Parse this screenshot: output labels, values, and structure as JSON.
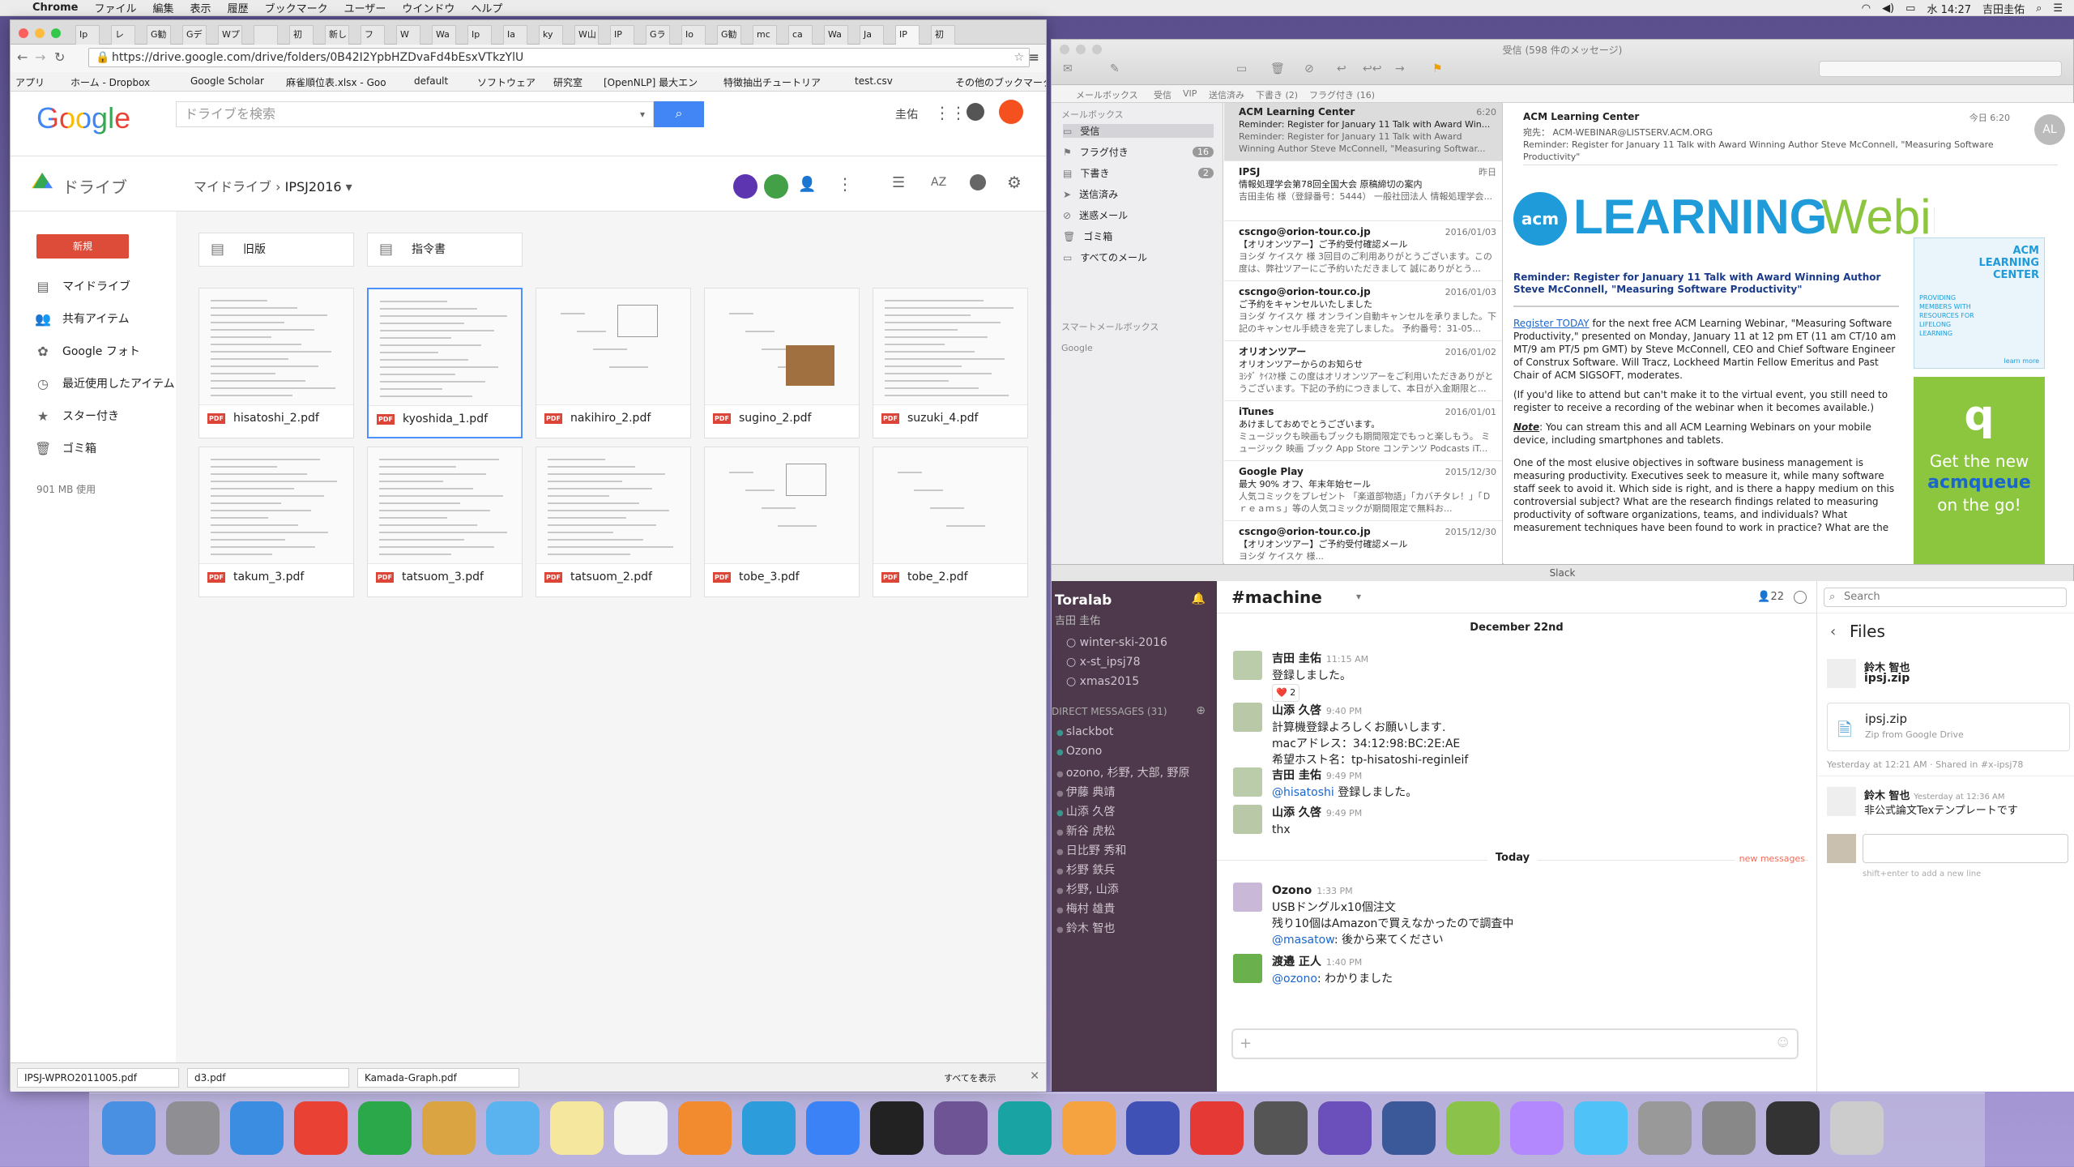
{
  "menubar": {
    "app": "Chrome",
    "items": [
      "ファイル",
      "編集",
      "表示",
      "履歴",
      "ブックマーク",
      "ユーザー",
      "ウインドウ",
      "ヘルプ"
    ],
    "clock": "水 14:27",
    "user": "吉田圭佑"
  },
  "chrome": {
    "tabs": [
      "Ip",
      "レ",
      "G勧",
      "Gデ",
      "Wプ",
      "",
      "初",
      "新し",
      "フ",
      "W",
      "Wa",
      "Ip",
      "Ia",
      "ky",
      "W山",
      "IP",
      "Gラ",
      "Io",
      "G勧",
      "mc",
      "ca",
      "Wa",
      "Ja",
      "IP",
      "初"
    ],
    "url": "https://drive.google.com/drive/folders/0B42I2YpbHZDvaFd4bEsxVTkzYlU",
    "bookmarks": [
      "アプリ",
      "ホーム - Dropbox",
      "Google Scholar",
      "麻雀順位表.xlsx - Goo",
      "default",
      "ソフトウェア",
      "研究室",
      "[OpenNLP] 最大エン",
      "特徴抽出チュートリア",
      "test.csv",
      "その他のブックマーク"
    ],
    "logo": "Google",
    "search_placeholder": "ドライブを検索",
    "user_short": "圭佑",
    "drive_label": "ドライブ",
    "breadcrumb": {
      "root": "マイドライブ",
      "current": "IPSJ2016"
    },
    "new_button": "新規",
    "sidebar": [
      "マイドライブ",
      "共有アイテム",
      "Google フォト",
      "最近使用したアイテム",
      "スター付き",
      "ゴミ箱"
    ],
    "storage": "901 MB 使用",
    "folders": [
      "旧版",
      "指令書"
    ],
    "files": [
      "hisatoshi_2.pdf",
      "kyoshida_1.pdf",
      "nakihiro_2.pdf",
      "sugino_2.pdf",
      "suzuki_4.pdf",
      "takum_3.pdf",
      "tatsuom_3.pdf",
      "tatsuom_2.pdf",
      "tobe_3.pdf",
      "tobe_2.pdf"
    ],
    "downloads": [
      "IPSJ-WPRO2011005.pdf",
      "d3.pdf",
      "Kamada-Graph.pdf"
    ],
    "show_all": "すべてを表示"
  },
  "mail": {
    "window_title": "受信 (598 件のメッセージ)",
    "fav": [
      "メールボックス",
      "受信",
      "VIP",
      "送信済み",
      "下書き (2)",
      "フラグ付き (16)"
    ],
    "sidebar_header": "メールボックス",
    "mailboxes": [
      {
        "label": "受信",
        "count": ""
      },
      {
        "label": "フラグ付き",
        "count": "16"
      },
      {
        "label": "下書き",
        "count": "2"
      },
      {
        "label": "送信済み",
        "count": ""
      },
      {
        "label": "迷惑メール",
        "count": ""
      },
      {
        "label": "ゴミ箱",
        "count": ""
      },
      {
        "label": "すべてのメール",
        "count": ""
      }
    ],
    "smart": "スマートメールボックス",
    "google": "Google",
    "messages": [
      {
        "from": "ACM Learning Center",
        "date": "6:20",
        "subject": "Reminder: Register for January 11 Talk with Award Win...",
        "preview": "Reminder: Register for January 11 Talk with Award Winning Author Steve McConnell, \"Measuring Softwar..."
      },
      {
        "from": "IPSJ",
        "date": "昨日",
        "subject": "情報処理学会第78回全国大会 原稿締切の案内",
        "preview": "吉田圭佑 様（登録番号：5444） 一般社団法人 情報処理学会..."
      },
      {
        "from": "cscngo@orion-tour.co.jp",
        "date": "2016/01/03",
        "subject": "【オリオンツアー】ご予約受付確認メール",
        "preview": "ヨシダ ケイスケ 様 3回目のご利用ありがとうございます。この度は、弊社ツアーにご予約いただきまして 誠にありがとう..."
      },
      {
        "from": "cscngo@orion-tour.co.jp",
        "date": "2016/01/03",
        "subject": "ご予約をキャンセルいたしました",
        "preview": "ヨシダ ケイスケ 様 オンライン自動キャンセルを承りました。下記のキャンセル手続きを完了しました。 予約番号：31-05..."
      },
      {
        "from": "オリオンツアー",
        "date": "2016/01/02",
        "subject": "オリオンツアーからのお知らせ",
        "preview": "ﾖｼﾀﾞ ｹｲｽｹ様 この度はオリオンツアーをご利用いただきありがとうございます。下記の予約につきまして、本日が入金期限と..."
      },
      {
        "from": "iTunes",
        "date": "2016/01/01",
        "subject": "あけましておめでとうございます。",
        "preview": "ミュージックも映画もブックも期間限定でもっと楽しもう。 ミュージック 映画 ブック App Store コンテンツ Podcasts iT..."
      },
      {
        "from": "Google Play",
        "date": "2015/12/30",
        "subject": "最大 90% オフ、年末年始セール",
        "preview": "人気コミックをプレゼント 「楽道部物語」「カバチタレ！」「Ｄｒｅａｍｓ」等の人気コミックが期間限定で無料お..."
      },
      {
        "from": "cscngo@orion-tour.co.jp",
        "date": "2015/12/30",
        "subject": "【オリオンツアー】ご予約受付確認メール",
        "preview": "ヨシダ ケイスケ 様..."
      }
    ],
    "reader": {
      "from": "ACM Learning Center",
      "date": "今日 6:20",
      "to_label": "宛先：",
      "to": "ACM-WEBINAR@LISTSERV.ACM.ORG",
      "subject": "Reminder: Register for January 11 Talk with Award Winning Author Steve McConnell, \"Measuring Software Productivity\"",
      "avatar": "AL",
      "banner_learning": "LEARNING",
      "banner_webinar": "Webinar",
      "acm": "acm",
      "headline": "Reminder: Register for January 11 Talk with Award Winning Author Steve McConnell, \"Measuring Software Productivity\"",
      "p1_link": "Register TODAY",
      "p1": " for the next free ACM Learning Webinar, \"Measuring Software Productivity,\" presented on Monday, January 11 at 12 pm ET (11 am CT/10 am MT/9 am PT/5 pm GMT) by Steve McConnell, CEO and Chief Software Engineer of Construx Software. Will Tracz, Lockheed Martin Fellow Emeritus and Past Chair of ACM SIGSOFT, moderates.",
      "p2": "(If you'd like to attend but can't make it to the virtual event, you still need to register to receive a recording of the webinar when it becomes available.)",
      "p3_note": "Note",
      "p3": ": You can stream this and all ACM Learning Webinars on your mobile device, including smartphones and tablets.",
      "p4": "One of the most elusive objectives in software business management is measuring productivity. Executives seek to measure it, while many software staff seek to avoid it. Which side is right, and is there a happy medium on this controversial subject? What are the research findings related to measuring productivity of software organizations, teams, and individuals? What measurement techniques have been found to work in practice? What are the",
      "side1": "ACM LEARNING CENTER",
      "side1b": "PROVIDING MEMBERS WITH RESOURCES FOR LIFELONG LEARNING",
      "side1c": "learn more",
      "side2": "Get the new",
      "side2b": "acmqueue",
      "side2c": "on the go!"
    }
  },
  "slack": {
    "title": "Slack",
    "team": "Toralab",
    "user": "吉田 圭佑",
    "channels": [
      "winter-ski-2016",
      "x-st_ipsj78",
      "xmas2015"
    ],
    "dm_header": "DIRECT MESSAGES (31)",
    "dms": [
      "slackbot",
      "Ozono",
      "ozono, 杉野, 大部, 野原",
      "伊藤 典靖",
      "山添 久啓",
      "新谷 虎松",
      "日比野 秀和",
      "杉野 鉄兵",
      "杉野, 山添",
      "梅村 雄貴",
      "鈴木 智也"
    ],
    "channel": "#machine",
    "members": "22",
    "search": "Search",
    "date1": "December 22nd",
    "today": "Today",
    "new_messages": "new messages",
    "messages": [
      {
        "name": "吉田 圭佑",
        "time": "11:15 AM",
        "lines": [
          "登録しました。"
        ],
        "reaction": "❤️ 2"
      },
      {
        "name": "山添 久啓",
        "time": "9:40 PM",
        "lines": [
          "計算機登録よろしくお願いします.",
          "macアドレス：34:12:98:BC:2E:AE",
          "希望ホスト名：tp-hisatoshi-reginleif"
        ]
      },
      {
        "name": "吉田 圭佑",
        "time": "9:49 PM",
        "mention": "@hisatoshi",
        "lines": [
          " 登録しました。"
        ]
      },
      {
        "name": "山添 久啓",
        "time": "9:49 PM",
        "lines": [
          "thx"
        ]
      },
      {
        "name": "Ozono",
        "time": "1:33 PM",
        "lines": [
          "USBドングルx10個注文",
          "残り10個はAmazonで買えなかったので調査中"
        ],
        "mention_line": "@masatow",
        "mention_rest": ": 後から来てください"
      },
      {
        "name": "渡邉 正人",
        "time": "1:40 PM",
        "mention": "@ozono",
        "lines": [
          ": わかりました"
        ]
      }
    ],
    "files_header": "Files",
    "files": [
      {
        "user": "鈴木 智也",
        "file": "ipsj.zip"
      },
      {
        "file": "ipsj.zip",
        "sub": "Zip from Google Drive"
      }
    ],
    "file_meta": "Yesterday at 12:21 AM · Shared in #x-ipsj78",
    "comment": {
      "user": "鈴木 智也",
      "time": "Yesterday at 12:36 AM",
      "text": "非公式論文Texテンプレートです"
    },
    "hint": "shift+enter to add a new line"
  },
  "dock": {
    "count": 28
  }
}
